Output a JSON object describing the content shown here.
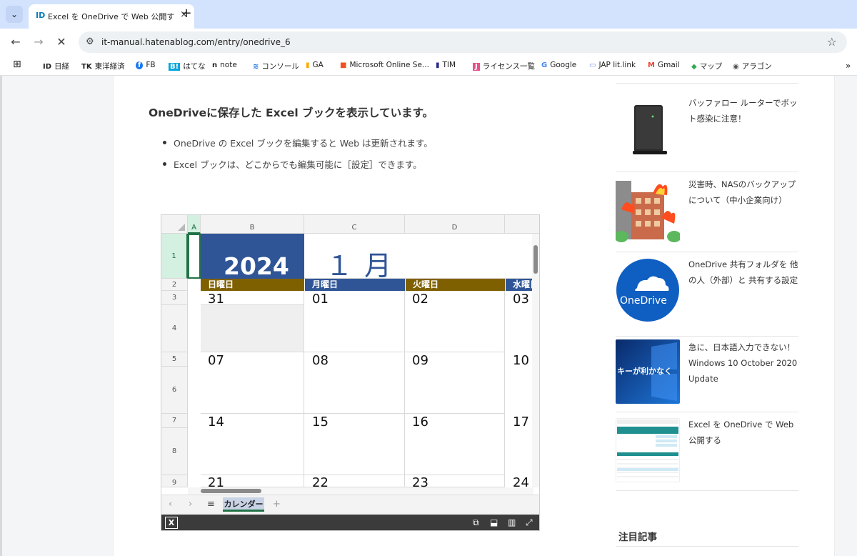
{
  "browser": {
    "tab_title": "Excel を OneDrive で Web 公開す",
    "tab_favicon": "ID",
    "url": "it-manual.hatenablog.com/entry/onedrive_6",
    "bookmarks": [
      {
        "icon": "ID",
        "label": "日経"
      },
      {
        "icon": "TK",
        "label": "東洋経済"
      },
      {
        "icon": "f",
        "label": "FB"
      },
      {
        "icon": "B!",
        "label": "はてな"
      },
      {
        "icon": "n",
        "label": "note"
      },
      {
        "icon": "≋",
        "label": "コンソール"
      },
      {
        "icon": "▮",
        "label": "GA"
      },
      {
        "icon": "■",
        "label": "Microsoft Online Se..."
      },
      {
        "icon": "▮",
        "label": "TIM"
      },
      {
        "icon": "J",
        "label": "ライセンス一覧"
      },
      {
        "icon": "G",
        "label": "Google"
      },
      {
        "icon": "▭",
        "label": "JAP lit.link"
      },
      {
        "icon": "M",
        "label": "Gmail"
      },
      {
        "icon": "◆",
        "label": "マップ"
      },
      {
        "icon": "◉",
        "label": "アラゴン"
      }
    ]
  },
  "article": {
    "heading": "OneDriveに保存した Excel ブックを表示しています。",
    "bullets": [
      "OneDrive の Excel ブックを編集すると Web は更新されます。",
      "Excel ブックは、どこからでも編集可能に［設定］できます。"
    ]
  },
  "excel": {
    "columns": [
      "A",
      "B",
      "C",
      "D"
    ],
    "rows": [
      "1",
      "2",
      "3",
      "4",
      "5",
      "6",
      "7",
      "8",
      "9"
    ],
    "year": "2024",
    "month": "１ 月",
    "day_headers": [
      "日曜日",
      "月曜日",
      "火曜日",
      "水曜日"
    ],
    "week1": [
      "31",
      "01",
      "02",
      "03"
    ],
    "week2": [
      "07",
      "08",
      "09",
      "10"
    ],
    "week3": [
      "14",
      "15",
      "16",
      "17"
    ],
    "week4": [
      "21",
      "22",
      "23",
      "24"
    ],
    "sheet_tab": "カレンダー",
    "colors": {
      "header_blue": "#2f5597",
      "header_brown": "#7f6000",
      "selection_green": "#217346"
    }
  },
  "sidebar": {
    "items": [
      {
        "title": "バッファロー ルーターでボット感染に注意！",
        "thumb": "router"
      },
      {
        "title": "災害時、NASのバックアップについて（中小企業向け）",
        "thumb": "fire-building"
      },
      {
        "title": "OneDrive 共有フォルダを 他の人（外部）と 共有する設定",
        "thumb": "onedrive"
      },
      {
        "title": "急に、日本語入力できない！ Windows 10 October 2020 Update",
        "thumb": "windows"
      },
      {
        "title": "Excel を OneDrive で Web 公開する",
        "thumb": "excel-screenshot"
      }
    ],
    "thumb_onedrive_label": "OneDrive",
    "thumb_windows_label": "キーが利かなく",
    "featured_heading": "注目記事"
  }
}
